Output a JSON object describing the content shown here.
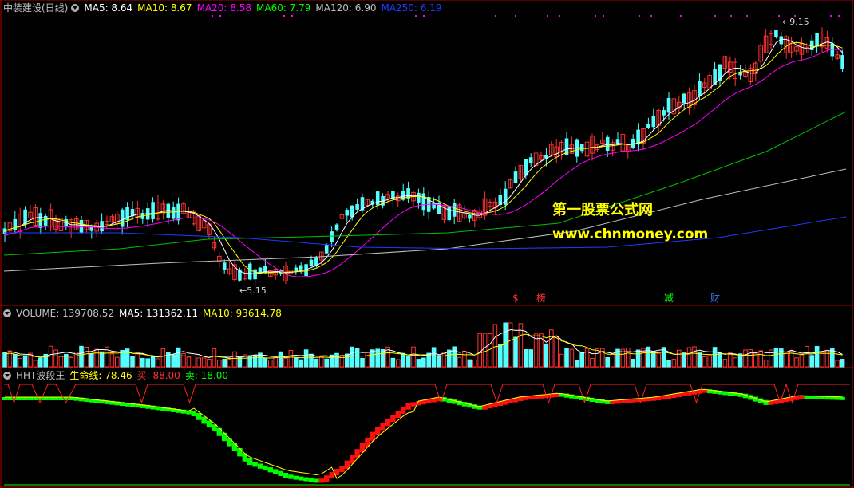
{
  "main_panel": {
    "title": "中装建设(日线)",
    "ma_lines": [
      {
        "label": "MA5: 8.64",
        "color": "#ffffff"
      },
      {
        "label": "MA10: 8.67",
        "color": "#ffff00"
      },
      {
        "label": "MA20: 8.58",
        "color": "#ff00ff"
      },
      {
        "label": "MA60: 7.79",
        "color": "#00ff00"
      },
      {
        "label": "MA120: 6.90",
        "color": "#c0c0c0"
      },
      {
        "label": "MA250: 6.19",
        "color": "#1e3cff"
      }
    ],
    "high_label": "9.15",
    "low_label": "5.15",
    "events": [
      {
        "text": "$",
        "color": "#ff3030"
      },
      {
        "text": "榜",
        "color": "#ff3030"
      },
      {
        "text": "减",
        "color": "#00ff00"
      },
      {
        "text": "财",
        "color": "#4080ff"
      }
    ]
  },
  "watermark": {
    "line1": "第一股票公式网",
    "line2": "www.chnmoney.com"
  },
  "volume_panel": {
    "title": "VOLUME: 139708.52",
    "ma5": "MA5: 131362.11",
    "ma10": "MA10: 93614.78"
  },
  "indicator_panel": {
    "title": "HHT波段王",
    "life_line": "生命线: 78.46",
    "buy": "买: 88.00",
    "sell": "卖: 18.00"
  },
  "colors": {
    "up": "#ff3232",
    "down": "#54ffff",
    "bg": "#000000",
    "frame": "#b00000"
  }
}
